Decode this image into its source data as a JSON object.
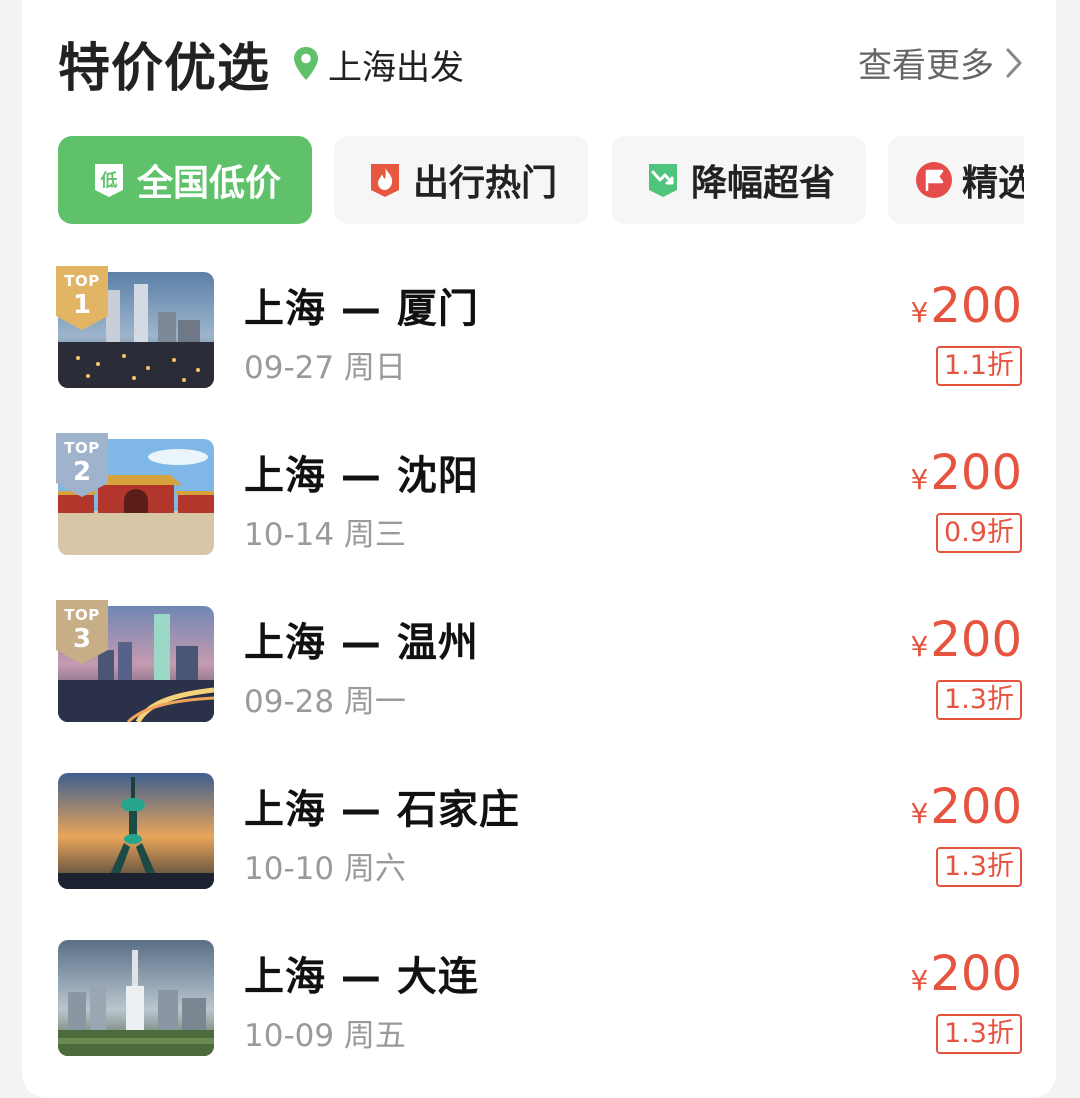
{
  "header": {
    "title": "特价优选",
    "departure": "上海出发",
    "more_label": "查看更多"
  },
  "tabs": [
    {
      "label": "全国低价",
      "icon": "low-price-icon",
      "active": true
    },
    {
      "label": "出行热门",
      "icon": "fire-icon",
      "active": false
    },
    {
      "label": "降幅超省",
      "icon": "price-drop-icon",
      "active": false
    },
    {
      "label": "精选",
      "icon": "flag-icon",
      "active": false
    }
  ],
  "rank_badge_text": "TOP",
  "colors": {
    "accent_green": "#5fc26a",
    "price_red": "#e6533f",
    "gold": "#e2b565",
    "silver": "#9fb3cc",
    "bronze": "#c8ae86"
  },
  "routes": [
    {
      "route": "上海 — 厦门",
      "date": "09-27 周日",
      "currency": "¥",
      "price": "200",
      "discount": "1.1折",
      "rank": "1",
      "image": "xiamen-skyline-photo"
    },
    {
      "route": "上海 — 沈阳",
      "date": "10-14 周三",
      "currency": "¥",
      "price": "200",
      "discount": "0.9折",
      "rank": "2",
      "image": "shenyang-palace-photo"
    },
    {
      "route": "上海 — 温州",
      "date": "09-28 周一",
      "currency": "¥",
      "price": "200",
      "discount": "1.3折",
      "rank": "3",
      "image": "wenzhou-city-photo"
    },
    {
      "route": "上海 — 石家庄",
      "date": "10-10 周六",
      "currency": "¥",
      "price": "200",
      "discount": "1.3折",
      "image": "shijiazhuang-tower-photo"
    },
    {
      "route": "上海 — 大连",
      "date": "10-09 周五",
      "currency": "¥",
      "price": "200",
      "discount": "1.3折",
      "image": "dalian-city-photo"
    }
  ]
}
